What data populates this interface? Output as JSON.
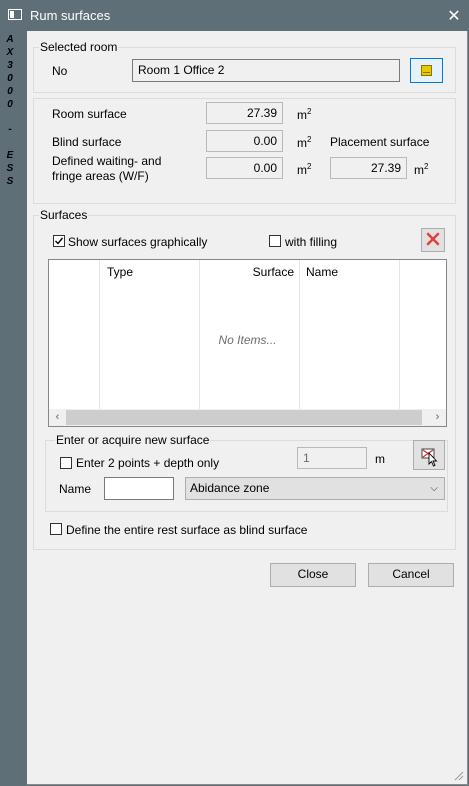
{
  "window": {
    "title": "Rum surfaces",
    "side_text": "A\nX\n3\n0\n0\n0\n\n-\n\nE\nS\nS"
  },
  "selected_room": {
    "group_label": "Selected room",
    "no_label": "No",
    "room_value": "Room 1 Office 2"
  },
  "surfaces_info": {
    "room_surface_label": "Room surface",
    "room_surface_value": "27.39",
    "blind_surface_label": "Blind surface",
    "blind_surface_value": "0.00",
    "defined_label_line1": "Defined waiting- and",
    "defined_label_line2": "fringe areas (W/F)",
    "defined_value": "0.00",
    "placement_label": "Placement surface",
    "placement_value": "27.39",
    "unit_m": "m",
    "unit_sup": "2"
  },
  "surfaces": {
    "group_label": "Surfaces",
    "show_graphically_label": "Show surfaces graphically",
    "show_graphically_checked": true,
    "with_filling_label": "with filling",
    "with_filling_checked": false,
    "columns": [
      "Type",
      "Surface",
      "Name"
    ],
    "empty_text": "No Items..."
  },
  "new_surface": {
    "group_label": "Enter or acquire new surface",
    "enter_points_label": "Enter 2 points + depth only",
    "enter_points_checked": false,
    "depth_value": "1",
    "depth_unit": "m",
    "name_label": "Name",
    "name_value": "",
    "zone_selected": "Abidance zone"
  },
  "define_rest_label": "Define the entire rest surface as blind surface",
  "define_rest_checked": false,
  "buttons": {
    "close": "Close",
    "cancel": "Cancel"
  },
  "colors": {
    "title_bar": "#5f6f77",
    "client_bg": "#f0f0f0",
    "delete_red": "#e04040"
  }
}
